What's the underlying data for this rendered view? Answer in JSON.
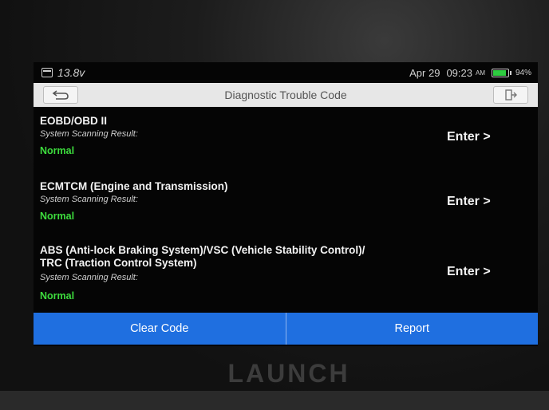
{
  "status_bar": {
    "voltage": "13.8v",
    "date": "Apr 29",
    "time": "09:23",
    "ampm": "AM",
    "battery_percent": "94%",
    "battery_level": 0.94,
    "battery_color": "#2ecc40"
  },
  "header": {
    "title": "Diagnostic Trouble Code",
    "back_icon": "back-arrow-icon",
    "exit_icon": "exit-icon"
  },
  "systems": [
    {
      "name": "EOBD/OBD II",
      "sub": "System Scanning Result:",
      "status": "Normal",
      "action": "Enter >"
    },
    {
      "name": "ECMTCM (Engine and Transmission)",
      "sub": "System Scanning Result:",
      "status": "Normal",
      "action": "Enter >"
    },
    {
      "name_line1": "ABS (Anti-lock Braking System)/VSC (Vehicle Stability Control)/",
      "name_line2": "TRC (Traction Control System)",
      "sub": "System Scanning Result:",
      "status": "Normal",
      "action": "Enter >"
    }
  ],
  "footer": {
    "clear_code": "Clear Code",
    "report": "Report"
  },
  "device": {
    "brand": "LAUNCH"
  },
  "colors": {
    "accent": "#1f6fe0",
    "status_normal": "#3ddc3d"
  }
}
